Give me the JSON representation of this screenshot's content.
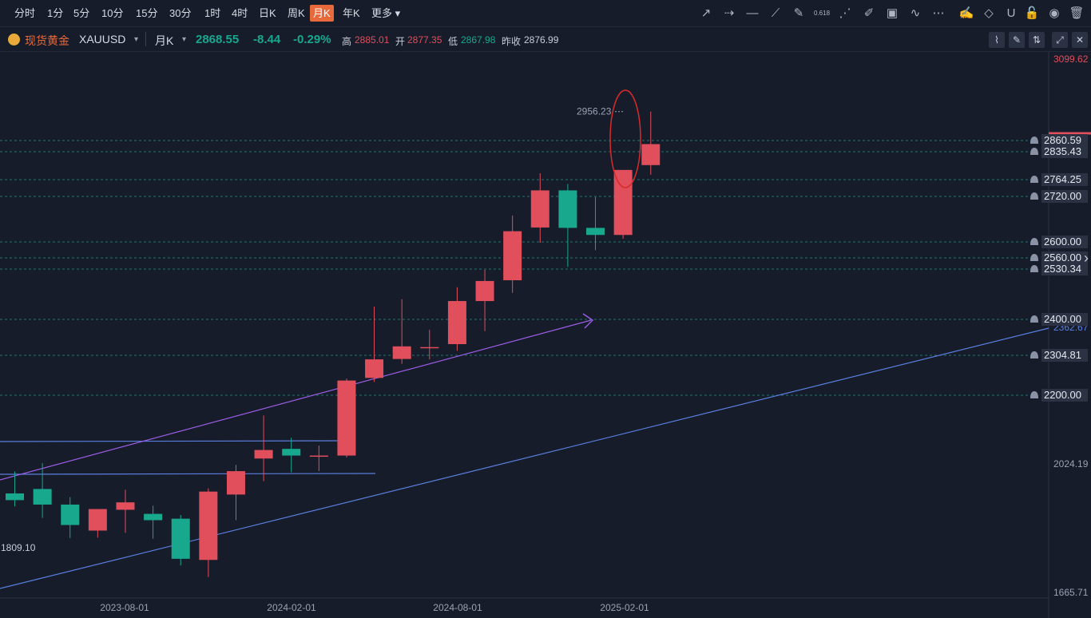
{
  "toolbar": {
    "timeframes": [
      "分时",
      "1分",
      "5分",
      "10分",
      "15分",
      "30分",
      "1时",
      "4时",
      "日K",
      "周K",
      "月K",
      "年K",
      "更多"
    ],
    "active": "月K",
    "more_caret": "▾",
    "tools": [
      "arrow-line-icon",
      "dashed-arrow-icon",
      "horizontal-line-icon",
      "polyline-icon",
      "pen-icon",
      "fibonacci-icon",
      "fan-icon",
      "highlighter-icon",
      "image-icon",
      "wave-icon",
      "more-dots-icon",
      "draw-edit-icon",
      "eraser-icon",
      "magnet-icon",
      "lock-icon",
      "eye-icon",
      "trash-icon"
    ],
    "fib_label": "0.618"
  },
  "info": {
    "symbol_name": "现货黄金",
    "symbol_code": "XAUUSD",
    "period": "月K",
    "caret": "▾",
    "price": "2868.55",
    "change": "-8.44",
    "change_pct": "-0.29%",
    "high_label": "高",
    "high": "2885.01",
    "open_label": "开",
    "open": "2877.35",
    "low_label": "低",
    "low": "2867.98",
    "prev_label": "昨收",
    "prev": "2876.99",
    "colors": {
      "up": "#e14e5c",
      "down": "#17a88e",
      "accent": "#e8693a",
      "gold": "#e8a93a"
    }
  },
  "chart_data": {
    "type": "candlestick",
    "x_ticks": [
      "2023-08-01",
      "2024-02-01",
      "2024-08-01",
      "2025-02-01"
    ],
    "y_axis_labels": [
      "3099.62",
      "2024.19",
      "1665.71"
    ],
    "ylim": [
      1665.71,
      3099.62
    ],
    "candles": [
      {
        "open": 1928.0,
        "high": 1987.0,
        "low": 1893.0,
        "close": 1910.0
      },
      {
        "open": 1940.0,
        "high": 2010.0,
        "low": 1862.0,
        "close": 1898.0
      },
      {
        "open": 1898.0,
        "high": 1918.0,
        "low": 1808.0,
        "close": 1843.0
      },
      {
        "open": 1828.0,
        "high": 1878.0,
        "low": 1809.1,
        "close": 1886.0
      },
      {
        "open": 1884.0,
        "high": 1938.0,
        "low": 1822.0,
        "close": 1904.0
      },
      {
        "open": 1873.0,
        "high": 1895.0,
        "low": 1806.0,
        "close": 1856.0
      },
      {
        "open": 1860.0,
        "high": 1870.0,
        "low": 1734.0,
        "close": 1752.0
      },
      {
        "open": 1749.0,
        "high": 1942.0,
        "low": 1703.0,
        "close": 1933.0
      },
      {
        "open": 1925.0,
        "high": 2005.0,
        "low": 1856.0,
        "close": 1988.0
      },
      {
        "open": 2022.0,
        "high": 2138.0,
        "low": 1961.0,
        "close": 2045.0
      },
      {
        "open": 2048.0,
        "high": 2078.0,
        "low": 1985.0,
        "close": 2030.0
      },
      {
        "open": 2029.0,
        "high": 2057.0,
        "low": 1988.0,
        "close": 2030.0
      },
      {
        "open": 2030.0,
        "high": 2237.0,
        "low": 2025.0,
        "close": 2232.0
      },
      {
        "open": 2239.0,
        "high": 2431.0,
        "low": 2228.0,
        "close": 2289.0
      },
      {
        "open": 2290.0,
        "high": 2451.0,
        "low": 2277.0,
        "close": 2324.0
      },
      {
        "open": 2322.0,
        "high": 2369.0,
        "low": 2289.0,
        "close": 2322.0
      },
      {
        "open": 2330.0,
        "high": 2483.0,
        "low": 2312.0,
        "close": 2446.0
      },
      {
        "open": 2446.0,
        "high": 2530.0,
        "low": 2365.0,
        "close": 2500.0
      },
      {
        "open": 2502.0,
        "high": 2676.0,
        "low": 2468.0,
        "close": 2634.0
      },
      {
        "open": 2644.0,
        "high": 2790.0,
        "low": 2603.0,
        "close": 2744.0
      },
      {
        "open": 2744.0,
        "high": 2761.0,
        "low": 2538.0,
        "close": 2643.0
      },
      {
        "open": 2643.0,
        "high": 2726.0,
        "low": 2583.0,
        "close": 2624.0
      },
      {
        "open": 2624.0,
        "high": 2790.0,
        "low": 2614.0,
        "close": 2799.0
      },
      {
        "open": 2812.0,
        "high": 2956.23,
        "low": 2786.0,
        "close": 2868.55
      }
    ],
    "price_lines": [
      {
        "label": "2860.59"
      },
      {
        "label": "2835.43"
      },
      {
        "label": "2764.25"
      },
      {
        "label": "2720.00"
      },
      {
        "label": "2600.00"
      },
      {
        "label": "2560.00"
      },
      {
        "label": "2530.34"
      },
      {
        "label": "2400.00"
      },
      {
        "label": "2304.81"
      },
      {
        "label": "2200.00"
      }
    ],
    "hidden_labels": [
      "2362.67"
    ],
    "annotations": {
      "high_label": "2956.23",
      "low_label": "1809.10"
    }
  }
}
